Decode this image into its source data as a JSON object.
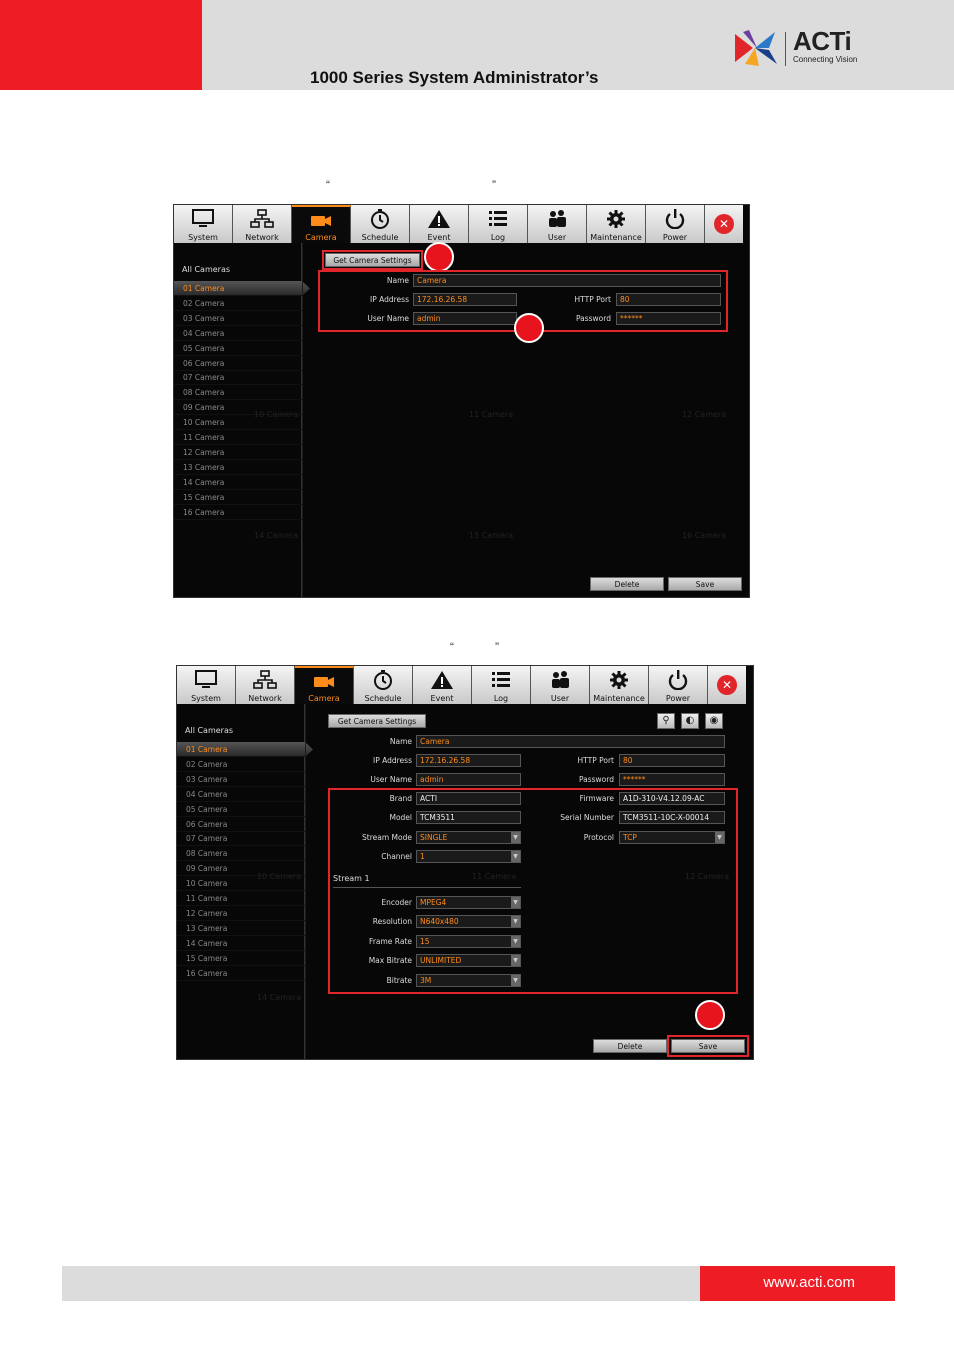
{
  "header": {
    "title": "1000 Series System Administrator’s",
    "logo_text": "ACTi",
    "logo_sub": "Connecting Vision"
  },
  "quotes": {
    "open": "“",
    "close": "”"
  },
  "footer": {
    "url": "www.acti.com"
  },
  "tabs": [
    {
      "label": "System",
      "icon": "monitor-icon"
    },
    {
      "label": "Network",
      "icon": "network-icon"
    },
    {
      "label": "Camera",
      "icon": "camera-icon"
    },
    {
      "label": "Schedule",
      "icon": "clock-icon"
    },
    {
      "label": "Event",
      "icon": "warning-icon"
    },
    {
      "label": "Log",
      "icon": "list-icon"
    },
    {
      "label": "User",
      "icon": "users-icon"
    },
    {
      "label": "Maintenance",
      "icon": "gear-icon"
    },
    {
      "label": "Power",
      "icon": "power-icon"
    }
  ],
  "close_glyph": "✕",
  "sidebar": {
    "title": "All Cameras",
    "items": [
      "01 Camera",
      "02 Camera",
      "03 Camera",
      "04 Camera",
      "05 Camera",
      "06 Camera",
      "07 Camera",
      "08 Camera",
      "09 Camera",
      "10 Camera",
      "11 Camera",
      "12 Camera",
      "13 Camera",
      "14 Camera",
      "15 Camera",
      "16 Camera"
    ]
  },
  "ghosts": [
    "10 Camera",
    "11 Camera",
    "12 Camera",
    "14 Camera",
    "15 Camera",
    "16 Camera",
    "Camera"
  ],
  "buttons": {
    "get_settings": "Get Camera Settings",
    "delete": "Delete",
    "save": "Save"
  },
  "form": {
    "name_label": "Name",
    "name_value": "Camera",
    "ip_label": "IP Address",
    "ip_value": "172.16.26.58",
    "http_label": "HTTP Port",
    "http_value": "80",
    "user_label": "User Name",
    "user_value": "admin",
    "pass_label": "Password",
    "pass_value": "******"
  },
  "details": {
    "brand_label": "Brand",
    "brand_value": "ACTI",
    "model_label": "Model",
    "model_value": "TCM3511",
    "stream_mode_label": "Stream Mode",
    "stream_mode_value": "SINGLE",
    "channel_label": "Channel",
    "channel_value": "1",
    "firmware_label": "Firmware",
    "firmware_value": "A1D-310-V4.12.09-AC",
    "serial_label": "Serial Number",
    "serial_value": "TCM3511-10C-X-00014",
    "protocol_label": "Protocol",
    "protocol_value": "TCP",
    "stream_title": "Stream 1",
    "encoder_label": "Encoder",
    "encoder_value": "MPEG4",
    "resolution_label": "Resolution",
    "resolution_value": "N640x480",
    "framerate_label": "Frame Rate",
    "framerate_value": "15",
    "maxbitrate_label": "Max Bitrate",
    "maxbitrate_value": "UNLIMITED",
    "bitrate_label": "Bitrate",
    "bitrate_value": "3M"
  },
  "colors": {
    "accent": "#ff8c1a",
    "red": "#e0262b",
    "brand_red": "#ee1c25"
  }
}
